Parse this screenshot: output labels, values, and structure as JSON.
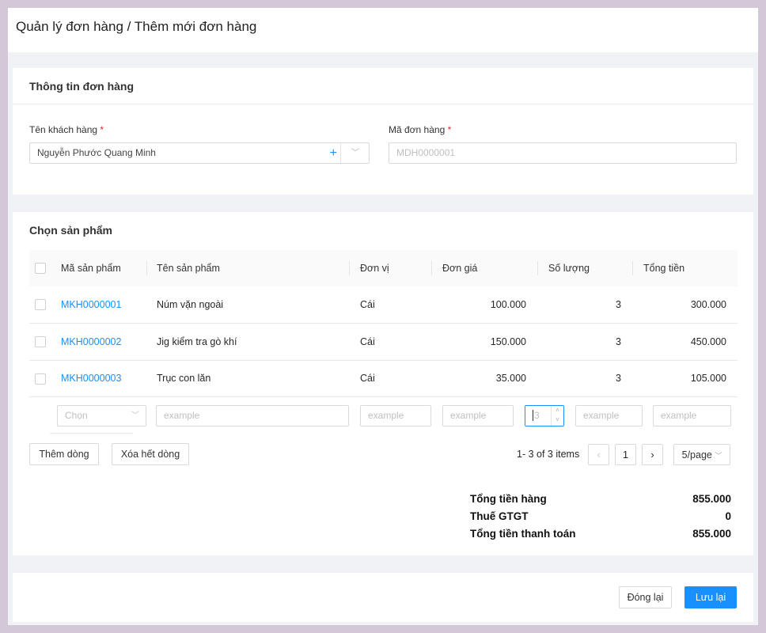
{
  "page": {
    "title": "Quản lý đơn hàng / Thêm mới đơn hàng"
  },
  "order_info": {
    "title": "Thông tin đơn hàng",
    "customer_label": "Tên khách hàng",
    "customer_value": "Nguyễn Phước Quang Minh",
    "order_code_label": "Mã đơn hàng",
    "order_code_placeholder": "MDH0000001",
    "required_mark": "*"
  },
  "products": {
    "title": "Chọn sản phẩm",
    "columns": [
      "Mã sản phẩm",
      "Tên sản phẩm",
      "Đơn vị",
      "Đơn giá",
      "Số lượng",
      "Tổng tiền"
    ],
    "rows": [
      {
        "code": "MKH0000001",
        "name": "Núm vặn ngoài",
        "unit": "Cái",
        "price": "100.000",
        "qty": "3",
        "total": "300.000"
      },
      {
        "code": "MKH0000002",
        "name": "Jig kiểm tra gò khí",
        "unit": "Cái",
        "price": "150.000",
        "qty": "3",
        "total": "450.000"
      },
      {
        "code": "MKH0000003",
        "name": "Trục con lăn",
        "unit": "Cái",
        "price": "35.000",
        "qty": "3",
        "total": "105.000"
      }
    ],
    "new_row": {
      "select_placeholder": "Chọn",
      "placeholder": "example",
      "qty_value": "3"
    },
    "add_row": "Thêm dòng",
    "clear_rows": "Xóa hết dòng",
    "pagination": {
      "info": "1- 3 of 3 items",
      "page": "1",
      "page_size": "5/page"
    }
  },
  "summary": {
    "subtotal_label": "Tổng tiền hàng",
    "subtotal": "855.000",
    "vat_label": "Thuế GTGT",
    "vat": "0",
    "total_label": "Tổng tiền thanh toán",
    "total": "855.000"
  },
  "footer": {
    "close": "Đóng lại",
    "save": "Lưu lại"
  },
  "colors": {
    "primary": "#1890ff",
    "required": "#f5222d"
  }
}
